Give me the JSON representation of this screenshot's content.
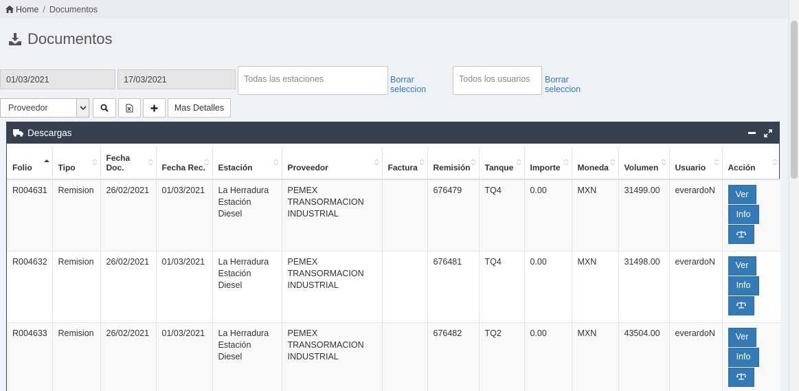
{
  "breadcrumb": {
    "home": "Home",
    "current": "Documentos"
  },
  "page": {
    "title": "Documentos"
  },
  "filters": {
    "date_from": "01/03/2021",
    "date_to": "17/03/2021",
    "stations_placeholder": "Todas las estaciones",
    "clear_stations": "Borrar seleccion",
    "users_placeholder": "Todos los usuarios",
    "clear_users": "Borrar seleccion"
  },
  "toolbar": {
    "select_value": "Proveedor",
    "more_details": "Mas Detalles"
  },
  "panel": {
    "title": "Descargas"
  },
  "table": {
    "headers": [
      "Folio",
      "Tipo",
      "Fecha Doc.",
      "Fecha Rec.",
      "Estación",
      "Proveedor",
      "Factura",
      "Remisión",
      "Tanque",
      "Importe",
      "Moneda",
      "Volumen",
      "Usuario",
      "Acción"
    ],
    "rows": [
      [
        "R004631",
        "Remision",
        "26/02/2021",
        "01/03/2021",
        "La Herradura Estación Diesel",
        "PEMEX TRANSORMACION INDUSTRIAL",
        "",
        "676479",
        "TQ4",
        "0.00",
        "MXN",
        "31499.00",
        "everardoN"
      ],
      [
        "R004632",
        "Remision",
        "26/02/2021",
        "01/03/2021",
        "La Herradura Estación Diesel",
        "PEMEX TRANSORMACION INDUSTRIAL",
        "",
        "676481",
        "TQ4",
        "0.00",
        "MXN",
        "31498.00",
        "everardoN"
      ],
      [
        "R004633",
        "Remision",
        "26/02/2021",
        "01/03/2021",
        "La Herradura Estación Diesel",
        "PEMEX TRANSORMACION INDUSTRIAL",
        "",
        "676482",
        "TQ2",
        "0.00",
        "MXN",
        "43504.00",
        "everardoN"
      ]
    ],
    "action_labels": {
      "view": "Ver",
      "info": "Info"
    }
  },
  "colors": {
    "header_bg": "#364150",
    "button_blue": "#337ab7",
    "link_blue": "#337ab7"
  },
  "icons": [
    "home-icon",
    "download-icon",
    "search-icon",
    "excel-icon",
    "plus-icon",
    "truck-icon",
    "minimize-icon",
    "expand-icon",
    "scale-icon",
    "sort-icon"
  ]
}
